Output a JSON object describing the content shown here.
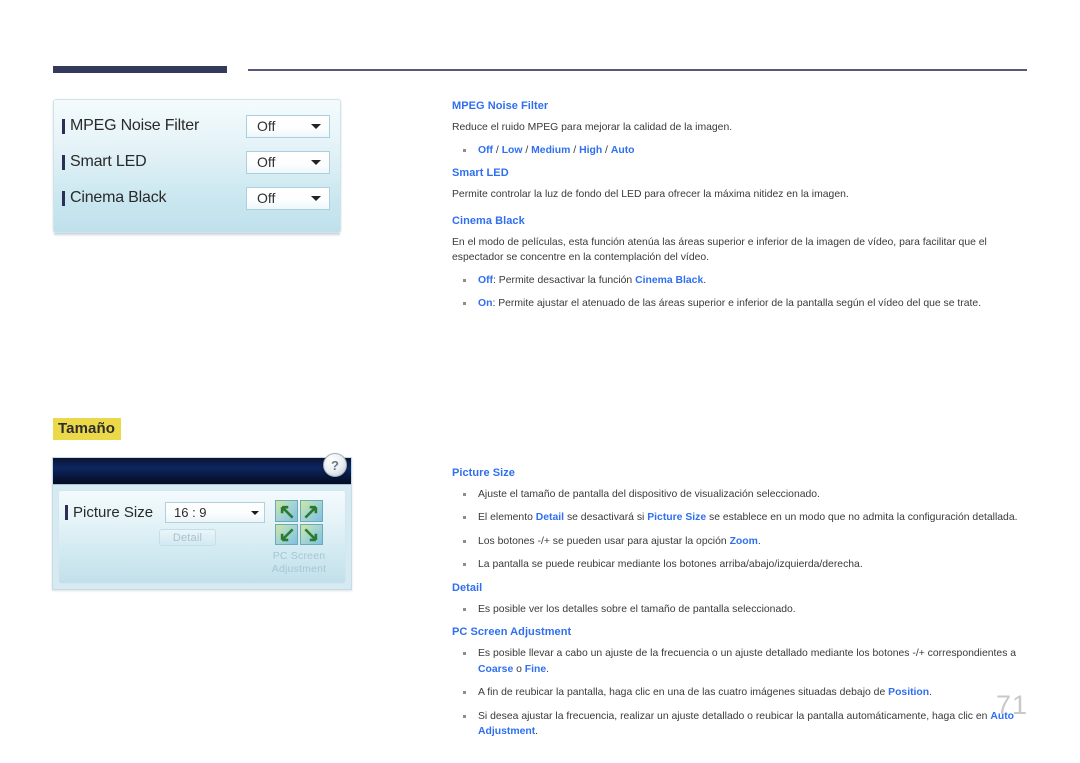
{
  "page": {
    "number": "71"
  },
  "ui_panel_picture": {
    "rows": [
      {
        "label": "MPEG Noise Filter",
        "value": "Off"
      },
      {
        "label": "Smart LED",
        "value": "Off"
      },
      {
        "label": "Cinema Black",
        "value": "Off"
      }
    ]
  },
  "section": {
    "heading": "Tamaño"
  },
  "ui_panel_size": {
    "help_label": "?",
    "picture_size_label": "Picture Size",
    "picture_size_value": "16 : 9",
    "detail_button": "Detail",
    "pc_screen_adjustment_line1": "PC Screen",
    "pc_screen_adjustment_line2": "Adjustment"
  },
  "doc": {
    "mpeg": {
      "heading": "MPEG Noise Filter",
      "body": "Reduce el ruido MPEG para mejorar la calidad de la imagen.",
      "options": [
        "Off",
        "Low",
        "Medium",
        "High",
        "Auto"
      ],
      "options_separator": " / "
    },
    "smart_led": {
      "heading": "Smart LED",
      "body": "Permite controlar la luz de fondo del LED para ofrecer la máxima nitidez en la imagen."
    },
    "cinema_black": {
      "heading": "Cinema Black",
      "body": "En el modo de películas, esta función atenúa las áreas superior e inferior de la imagen de vídeo, para facilitar que el espectador se concentre en la contemplación del vídeo.",
      "bullet_off_key": "Off",
      "bullet_off_text_a": ": Permite desactivar la función ",
      "bullet_off_emph": "Cinema Black",
      "bullet_off_text_b": ".",
      "bullet_on_key": "On",
      "bullet_on_text": ": Permite ajustar el atenuado de las áreas superior e inferior de la pantalla según el vídeo del que se trate."
    },
    "picture_size": {
      "heading": "Picture Size",
      "b1": "Ajuste el tamaño de pantalla del dispositivo de visualización seleccionado.",
      "b2_a": "El elemento ",
      "b2_k1": "Detail",
      "b2_b": " se desactivará si ",
      "b2_k2": "Picture Size",
      "b2_c": " se establece en un modo que no admita la configuración detallada.",
      "b3_a": "Los botones -/+ se pueden usar para ajustar la opción ",
      "b3_k": "Zoom",
      "b3_b": ".",
      "b4": "La pantalla se puede reubicar mediante los botones arriba/abajo/izquierda/derecha."
    },
    "detail": {
      "heading": "Detail",
      "b1": "Es posible ver los detalles sobre el tamaño de pantalla seleccionado."
    },
    "pc_screen_adjustment": {
      "heading": "PC Screen Adjustment",
      "b1_a": "Es posible llevar a cabo un ajuste de la frecuencia o un ajuste detallado mediante los botones -/+ correspondientes a ",
      "b1_k1": "Coarse",
      "b1_b": " o ",
      "b1_k2": "Fine",
      "b1_c": ".",
      "b2_a": "A fin de reubicar la pantalla, haga clic en una de las cuatro imágenes situadas debajo de ",
      "b2_k": "Position",
      "b2_b": ".",
      "b3_a": "Si desea ajustar la frecuencia, realizar un ajuste detallado o reubicar la pantalla automáticamente, haga clic en ",
      "b3_k": "Auto Adjustment",
      "b3_b": "."
    }
  },
  "colors": {
    "accent_blue": "#2f6ff0",
    "rule_navy": "#343a5c",
    "highlight_yellow": "#ecd94a",
    "page_number_gray": "#c9c9c9"
  }
}
